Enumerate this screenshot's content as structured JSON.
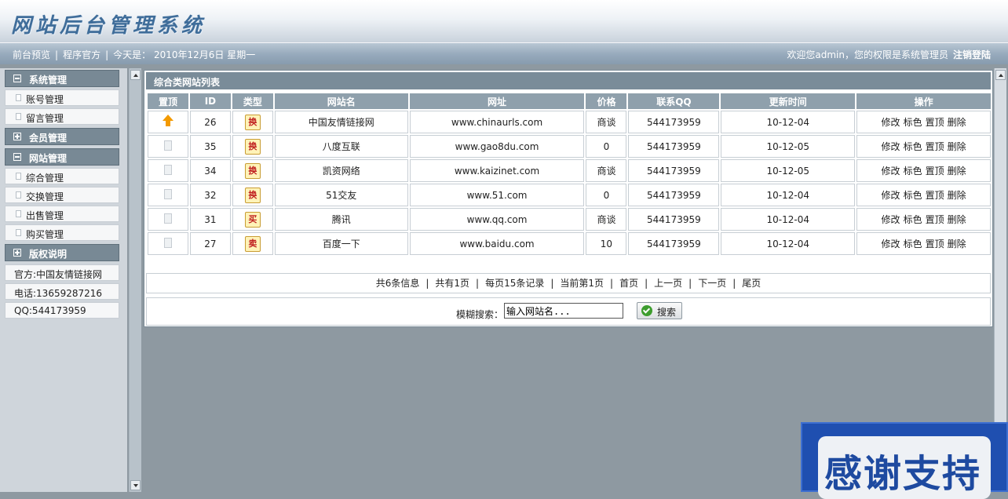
{
  "header": {
    "logo_text": "网站后台管理系统"
  },
  "navbar": {
    "front_preview": "前台预览",
    "official_site": "程序官方",
    "today_label": "今天是：",
    "date": "2010年12月6日",
    "weekday": "星期一",
    "welcome": "欢迎您admin，您的权限是系统管理员",
    "logout": "注销登陆"
  },
  "sidebar": {
    "groups": [
      {
        "title": "系统管理",
        "items": [
          "账号管理",
          "留言管理"
        ]
      },
      {
        "title": "会员管理",
        "items": []
      },
      {
        "title": "网站管理",
        "items": [
          "综合管理",
          "交换管理",
          "出售管理",
          "购买管理"
        ]
      },
      {
        "title": "版权说明",
        "info": [
          "官方:中国友情链接网",
          "电话:13659287216",
          "QQ:544173959"
        ]
      }
    ]
  },
  "panel": {
    "title": "综合类网站列表"
  },
  "table": {
    "headers": [
      "置顶",
      "ID",
      "类型",
      "网站名",
      "网址",
      "价格",
      "联系QQ",
      "更新时间",
      "操作"
    ],
    "rows": [
      {
        "top": "up-arrow-icon",
        "id": "26",
        "type": "换",
        "name": "中国友情链接网",
        "url": "www.chinaurls.com",
        "price": "商谈",
        "qq": "544173959",
        "time": "10-12-04"
      },
      {
        "top": "doc-icon",
        "id": "35",
        "type": "换",
        "name": "八度互联",
        "url": "www.gao8du.com",
        "price": "0",
        "qq": "544173959",
        "time": "10-12-05"
      },
      {
        "top": "doc-icon",
        "id": "34",
        "type": "换",
        "name": "凯资网络",
        "url": "www.kaizinet.com",
        "price": "商谈",
        "qq": "544173959",
        "time": "10-12-05"
      },
      {
        "top": "doc-icon",
        "id": "32",
        "type": "换",
        "name": "51交友",
        "url": "www.51.com",
        "price": "0",
        "qq": "544173959",
        "time": "10-12-04"
      },
      {
        "top": "doc-icon",
        "id": "31",
        "type": "买",
        "name": "腾讯",
        "url": "www.qq.com",
        "price": "商谈",
        "qq": "544173959",
        "time": "10-12-04"
      },
      {
        "top": "doc-icon",
        "id": "27",
        "type": "卖",
        "name": "百度一下",
        "url": "www.baidu.com",
        "price": "10",
        "qq": "544173959",
        "time": "10-12-04"
      }
    ],
    "actions": [
      "修改",
      "标色",
      "置顶",
      "删除"
    ]
  },
  "pager": {
    "total": "共6条信息",
    "pages": "共有1页",
    "per_page": "每页15条记录",
    "current": "当前第1页",
    "first": "首页",
    "prev": "上一页",
    "next": "下一页",
    "last": "尾页"
  },
  "search": {
    "label": "模糊搜索：",
    "value": "输入网站名...",
    "button": "搜索"
  },
  "overlay": {
    "text": "感谢支持"
  }
}
